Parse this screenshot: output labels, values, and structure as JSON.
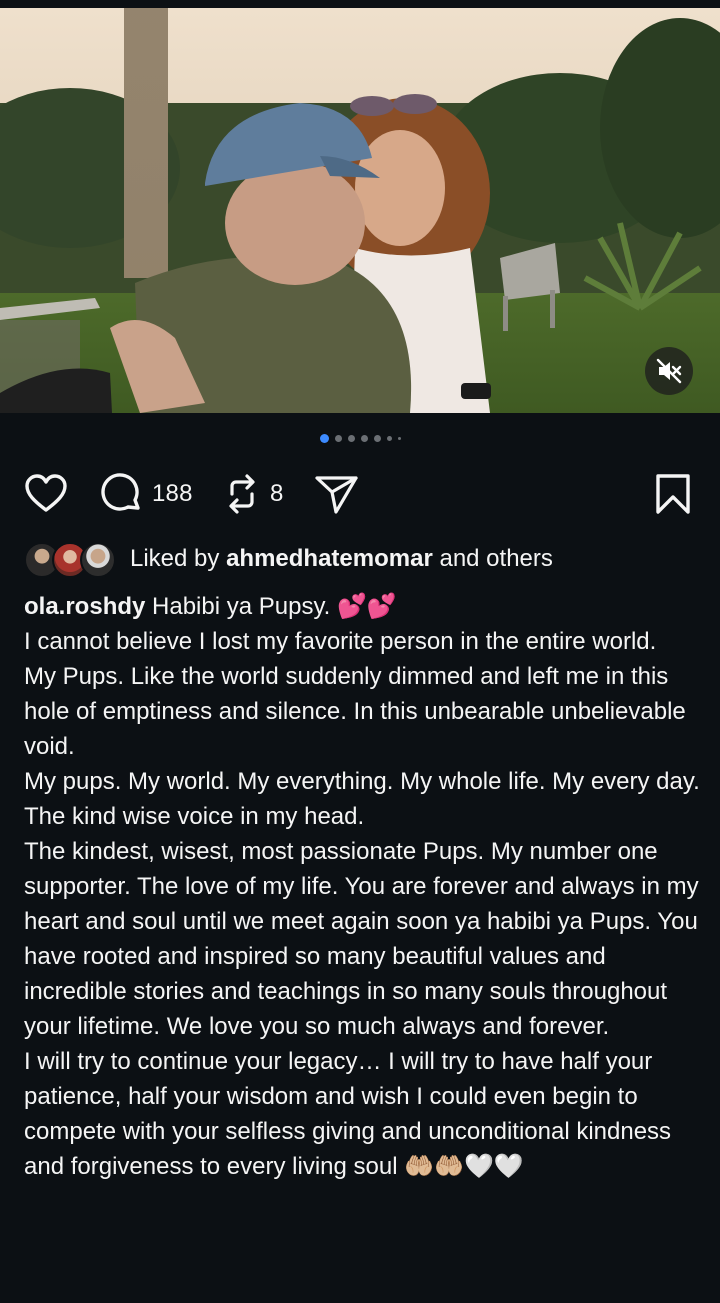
{
  "post": {
    "media_count": 7,
    "active_index": 0,
    "comment_count": "188",
    "repost_count": "8"
  },
  "liked": {
    "prefix": "Liked by",
    "user": "ahmedhatemomar",
    "suffix": "and others"
  },
  "caption": {
    "username": "ola.roshdy",
    "first_line": "Habibi ya Pupsy. 💕💕",
    "paragraphs": [
      "I cannot believe I lost my favorite person in the entire world.",
      "My Pups. Like the world suddenly dimmed and left me in this hole of emptiness and silence. In this unbearable unbelievable void.",
      "My pups. My world. My everything. My whole life. My every day. The kind wise voice in my head.",
      "The kindest, wisest, most passionate Pups. My number one supporter. The love of my life. You are forever and always in my heart and soul until we meet again soon ya habibi ya Pups. You have rooted and inspired so many beautiful values and incredible stories and teachings in so many souls throughout your lifetime. We love you so much always and forever.",
      "I will try to continue your legacy… I will try to have half your patience, half your wisdom and wish I could even begin to compete with your selfless giving and unconditional kindness and forgiveness to every living soul 🤲🏼🤲🏼🤍🤍"
    ]
  },
  "icons": {
    "like": "heart-outline-icon",
    "comment": "comment-bubble-icon",
    "repost": "repost-arrows-icon",
    "share": "paper-plane-icon",
    "save": "bookmark-icon",
    "mute": "speaker-muted-icon"
  },
  "colors": {
    "background": "#0c1014",
    "text": "#f5f5f5",
    "active_dot": "#3d8bff"
  }
}
